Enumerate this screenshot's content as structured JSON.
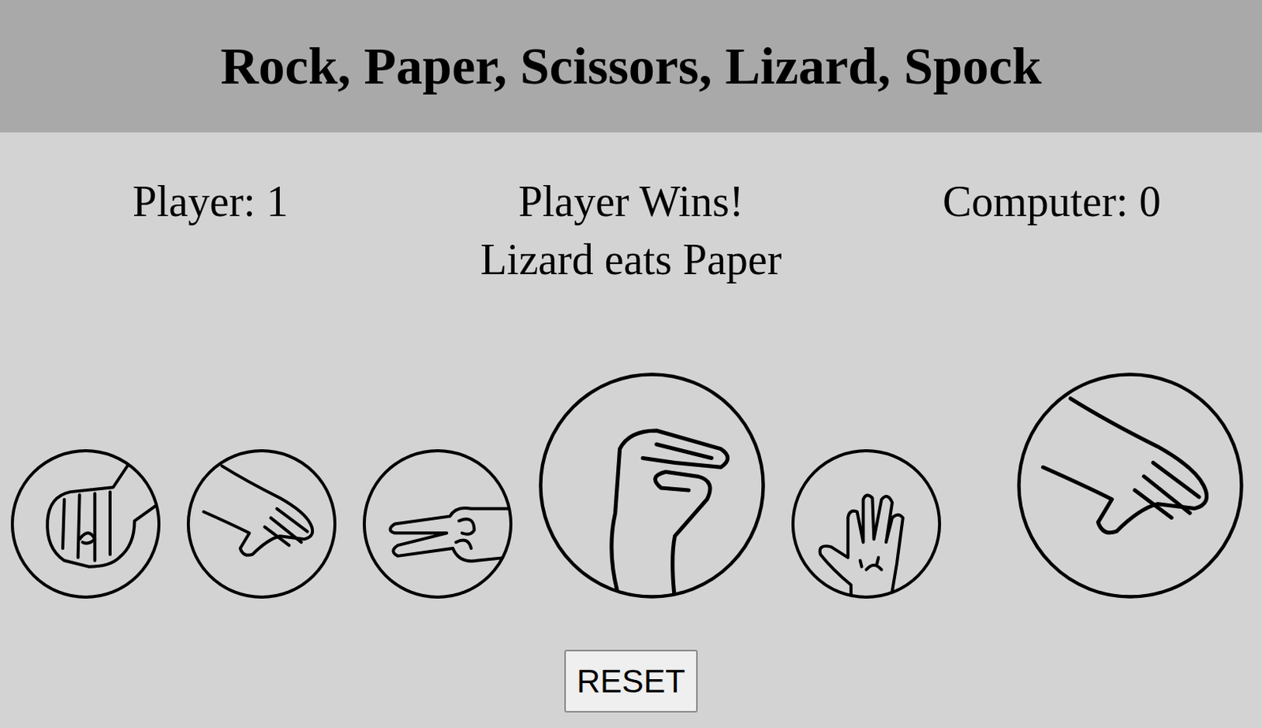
{
  "title": "Rock, Paper, Scissors, Lizard, Spock",
  "scores": {
    "player": "Player: 1",
    "computer": "Computer: 0"
  },
  "result": {
    "headline": "Player Wins!",
    "message": "Lizard eats Paper"
  },
  "choices": [
    {
      "kind": "rock",
      "selected": false
    },
    {
      "kind": "paper",
      "selected": false
    },
    {
      "kind": "scissors",
      "selected": false
    },
    {
      "kind": "lizard",
      "selected": true
    },
    {
      "kind": "spock",
      "selected": false
    }
  ],
  "computer_choice": {
    "kind": "paper"
  },
  "reset": {
    "label": "RESET"
  }
}
